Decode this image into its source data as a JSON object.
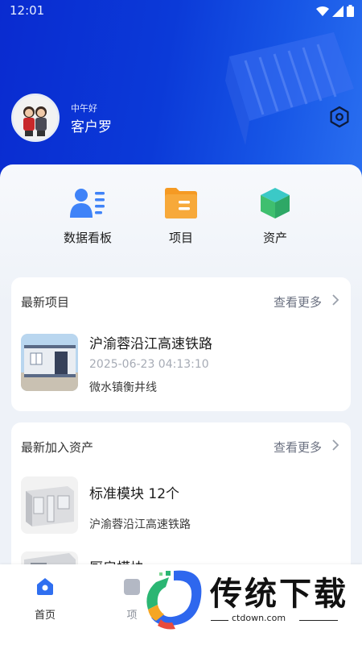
{
  "status": {
    "time": "12:01"
  },
  "profile": {
    "greeting": "中午好",
    "name": "客户罗"
  },
  "quick_actions": [
    {
      "label": "数据看板",
      "icon": "dashboard-users-icon"
    },
    {
      "label": "项目",
      "icon": "folder-icon"
    },
    {
      "label": "资产",
      "icon": "cube-icon"
    }
  ],
  "latest_projects": {
    "title": "最新项目",
    "more_label": "查看更多",
    "items": [
      {
        "name": "沪渝蓉沿江高速铁路",
        "time": "2025-06-23 04:13:10",
        "location": "微水镇衡井线"
      }
    ]
  },
  "latest_assets": {
    "title": "最新加入资产",
    "more_label": "查看更多",
    "items": [
      {
        "name": "标准模块 12个",
        "project": "沪渝蓉沿江高速铁路"
      },
      {
        "name": "厨房模块"
      }
    ]
  },
  "tabbar": [
    {
      "label": "首页",
      "active": true
    },
    {
      "label": "项"
    }
  ],
  "watermark": {
    "text": "传统下载",
    "url": "ctdown.com"
  },
  "colors": {
    "primary": "#0b3ad8",
    "accent_orange": "#f59a23",
    "accent_green": "#2bb673"
  }
}
